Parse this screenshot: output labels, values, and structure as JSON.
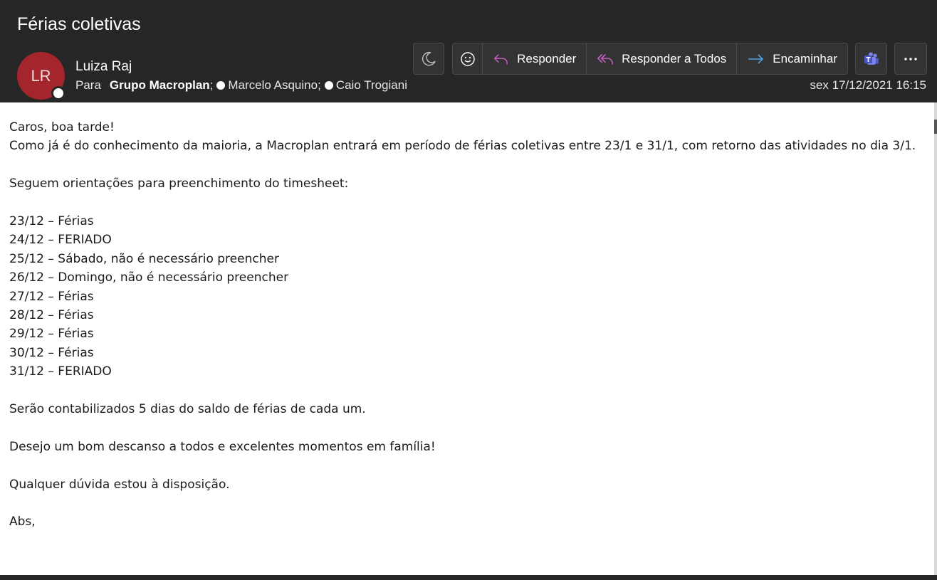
{
  "header": {
    "subject": "Férias coletivas",
    "avatar_initials": "LR",
    "avatar_color": "#a4262c",
    "sender_name": "Luiza Raj",
    "to_label": "Para",
    "to_group": "Grupo Macroplan",
    "to_people": [
      "Marcelo Asquino",
      "Caio Trogiani"
    ],
    "datetime": "sex 17/12/2021 16:15"
  },
  "toolbar": {
    "moon_icon": "moon-icon",
    "emoji_icon": "smiley-icon",
    "reply_label": "Responder",
    "reply_all_label": "Responder a Todos",
    "forward_label": "Encaminhar",
    "teams_icon": "teams-icon",
    "more_icon": "ellipsis-icon",
    "accent_reply": "#c85fc7",
    "accent_forward": "#4fa3e6"
  },
  "body": {
    "lines": [
      "Caros, boa tarde!",
      "Como já é do conhecimento da maioria, a Macroplan entrará em período de férias coletivas entre 23/1 e 31/1, com retorno das atividades no dia 3/1.",
      "",
      "Seguem orientações para preenchimento do timesheet:",
      "",
      "23/12 – Férias",
      "24/12 – FERIADO",
      "25/12 – Sábado, não é necessário preencher",
      "26/12 – Domingo, não é necessário preencher",
      "27/12 – Férias",
      "28/12 – Férias",
      "29/12 – Férias",
      "30/12 – Férias",
      "31/12 – FERIADO",
      "",
      "Serão contabilizados 5 dias do saldo de férias de cada um.",
      "",
      "Desejo um bom descanso a todos e excelentes momentos em família!",
      "",
      "Qualquer dúvida estou à disposição.",
      "",
      "Abs,"
    ]
  }
}
